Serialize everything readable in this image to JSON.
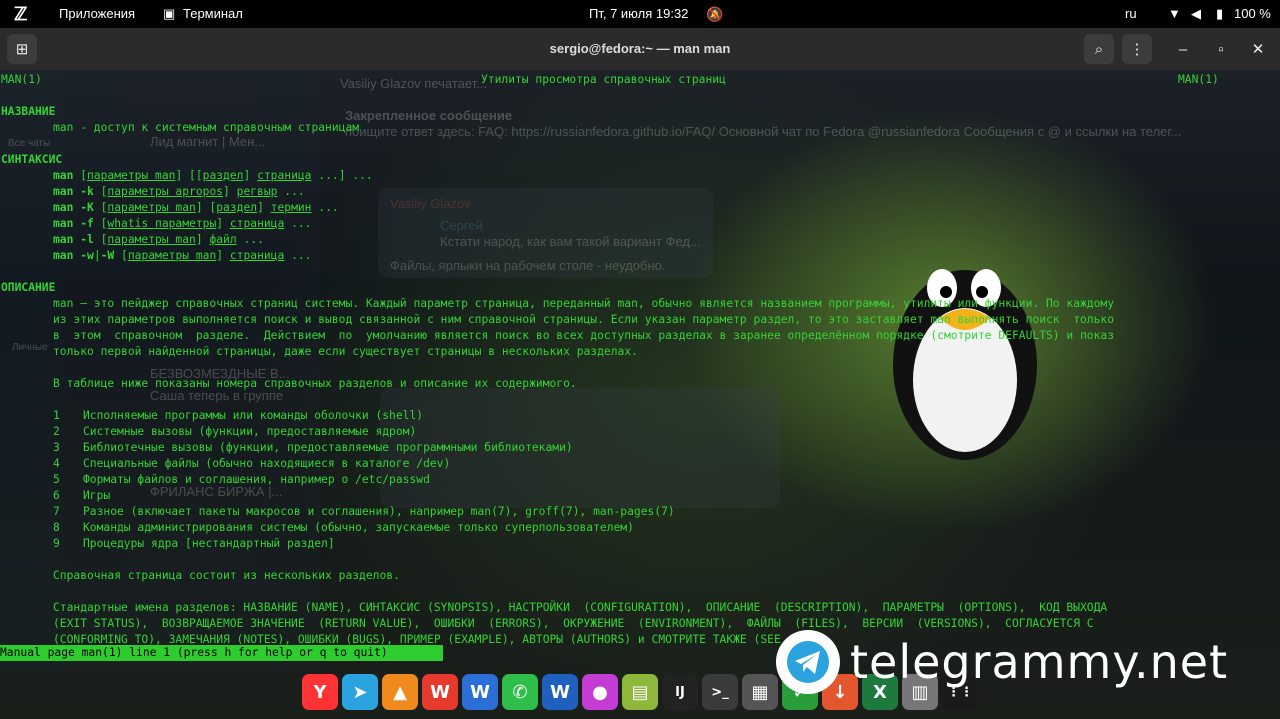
{
  "topbar": {
    "apps_label": "Приложения",
    "terminal_label": "Терминал",
    "datetime": "Пт, 7 июля  19:32",
    "lang": "ru",
    "battery": "100 %"
  },
  "window": {
    "title": "sergio@fedora:~ — man man"
  },
  "background_app": {
    "typing": "Vasiliy Glazov печатает...",
    "pinned_title": "Закрепленное сообщение",
    "pinned_text": "поищите ответ здесь: FAQ: https://russianfedora.github.io/FAQ/ Основной чат по Fedora @russianfedora Сообщения с @ и ссылки на телег...",
    "msg_sender": "Vasiliy Glazov",
    "msg_reply_name": "Сергей",
    "msg_reply_text": "Кстати народ, как вам такой вариант Фед...",
    "msg_text": "Файлы, ярлыки на рабочем столе - неудобно.",
    "chat1": "Лид магнит | Мен...",
    "chat2": "БЕЗВОЗМЕЗДНЫЕ В...",
    "chat2_preview": "Саша теперь в группе",
    "chat3": "ФРИЛАНС БИРЖА |...",
    "side_all": "Все чаты",
    "side_personal": "Личные"
  },
  "man": {
    "header_left": "MAN(1)",
    "header_center": "Утилиты просмотра справочных страниц",
    "header_right": "MAN(1)",
    "sec_name": "НАЗВАНИЕ",
    "name_line": "man - доступ к системным справочным страницам",
    "sec_synopsis": "СИНТАКСИС",
    "sec_description": "ОПИСАНИЕ",
    "desc_p1_l1": "man — это пейджер справочных страниц системы. Каждый параметр страница, переданный man, обычно является названием программы, утилиты или функции. По каждому",
    "desc_p1_l2": "из этих параметров выполняется поиск и вывод связанной с ним справочной страницы. Если указан параметр раздел, то это заставляет man выполнять поиск  только",
    "desc_p1_l3": "в  этом  справочном  разделе.  Действием  по  умолчанию является поиск во всех доступных разделах в заранее определённом порядке (смотрите DEFAULTS) и показ",
    "desc_p1_l4": "только первой найденной страницы, даже если существует страницы в нескольких разделах.",
    "table_intro": "В таблице ниже показаны номера справочных разделов и описание их содержимого.",
    "sections": [
      {
        "num": "1",
        "text": "Исполняемые программы или команды оболочки (shell)"
      },
      {
        "num": "2",
        "text": "Системные вызовы (функции, предоставляемые ядром)"
      },
      {
        "num": "3",
        "text": "Библиотечные вызовы (функции, предоставляемые программными библиотеками)"
      },
      {
        "num": "4",
        "text": "Специальные файлы (обычно находящиеся в каталоге /dev)"
      },
      {
        "num": "5",
        "text": "Форматы файлов и соглашения, например о /etc/passwd"
      },
      {
        "num": "6",
        "text": "Игры"
      },
      {
        "num": "7",
        "text": "Разное (включает пакеты макросов и соглашения), например man(7), groff(7), man-pages(7)"
      },
      {
        "num": "8",
        "text": "Команды администрирования системы (обычно, запускаемые только суперпользователем)"
      },
      {
        "num": "9",
        "text": "Процедуры ядра [нестандартный раздел]"
      }
    ],
    "page_parts": "Справочная страница состоит из нескольких разделов.",
    "std_l1": "Стандартные имена разделов: НАЗВАНИЕ (NAME), СИНТАКСИС (SYNOPSIS), НАСТРОЙКИ  (CONFIGURATION),  ОПИСАНИЕ  (DESCRIPTION),  ПАРАМЕТРЫ  (OPTIONS),  КОД ВЫХОДА",
    "std_l2": "(EXIT STATUS),  ВОЗВРАЩАЕМОЕ ЗНАЧЕНИЕ  (RETURN VALUE),  ОШИБКИ  (ERRORS),  ОКРУЖЕНИЕ  (ENVIRONMENT),  ФАЙЛЫ  (FILES),  ВЕРСИИ  (VERSIONS),  СОГЛАСУЕТСЯ С",
    "std_l3": "(CONFORMING TO), ЗАМЕЧАНИЯ (NOTES), ОШИБКИ (BUGS), ПРИМЕР (EXAMPLE), АВТОРЫ (AUTHORS) и СМОТРИТЕ ТАКЖЕ (SEE ALSO).",
    "status": "Manual page man(1) line 1 (press h for help or q to quit)"
  },
  "watermark": "telegrammy.net",
  "dock": [
    {
      "name": "yandex-browser",
      "glyph": "Y",
      "color": "#f33"
    },
    {
      "name": "telegram",
      "glyph": "➤",
      "color": "#2aa3df"
    },
    {
      "name": "vlc",
      "glyph": "▲",
      "color": "#f08a1c"
    },
    {
      "name": "wps-office",
      "glyph": "W",
      "color": "#e53a2c"
    },
    {
      "name": "writer",
      "glyph": "W",
      "color": "#2b6fd6"
    },
    {
      "name": "phone",
      "glyph": "✆",
      "color": "#2fbe4a"
    },
    {
      "name": "word",
      "glyph": "W",
      "color": "#1f5fbf"
    },
    {
      "name": "color-picker",
      "glyph": "●",
      "color": "#c43cd3"
    },
    {
      "name": "archive",
      "glyph": "▤",
      "color": "#8fb73b"
    },
    {
      "name": "intellij",
      "glyph": "IJ",
      "color": "#222"
    },
    {
      "name": "terminal",
      "glyph": ">_",
      "color": "#3a3a3a"
    },
    {
      "name": "calculator",
      "glyph": "▦",
      "color": "#555"
    },
    {
      "name": "sheets",
      "glyph": "✓",
      "color": "#2a9d3b"
    },
    {
      "name": "downloads",
      "glyph": "↓",
      "color": "#e4572e"
    },
    {
      "name": "excel",
      "glyph": "X",
      "color": "#1e7a3c"
    },
    {
      "name": "trash",
      "glyph": "▥",
      "color": "#777"
    },
    {
      "name": "app-grid",
      "glyph": "⋮⋮",
      "color": "#1a1a1a"
    }
  ]
}
